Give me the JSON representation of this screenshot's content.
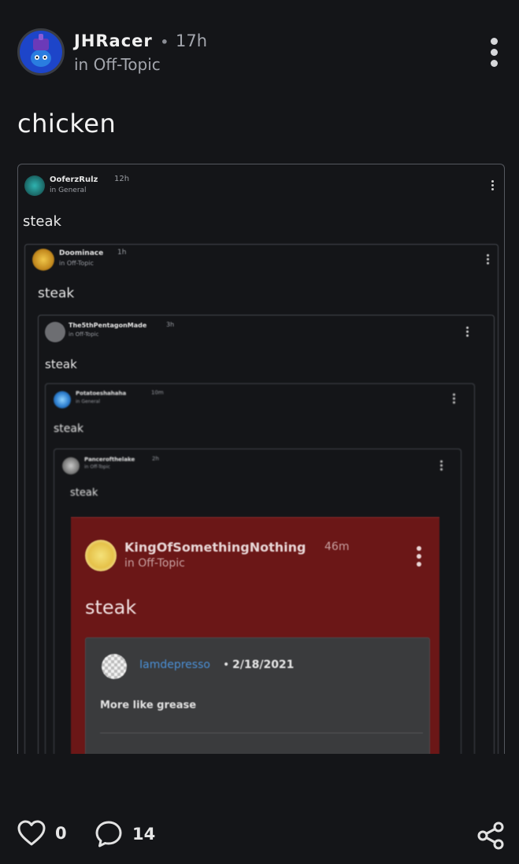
{
  "post": {
    "author": "JHRacer",
    "time": "17h",
    "community": "in Off-Topic",
    "text": "chicken"
  },
  "screenshot": {
    "level1": {
      "author": "OoferzRulz",
      "time": "12h",
      "community": "in General",
      "text": "steak"
    },
    "level2": {
      "author": "Doominace",
      "time": "1h",
      "community": "in Off-Topic",
      "text": "steak"
    },
    "level3": {
      "author": "The5thPentagonMade",
      "time": "3h",
      "community": "in Off-Topic",
      "text": "steak"
    },
    "level4": {
      "author": "Potatoeshahaha",
      "time": "10m",
      "community": "in General",
      "text": "steak"
    },
    "level5": {
      "author": "Pancerofthelake",
      "time": "2h",
      "community": "in Off-Topic",
      "text": "steak"
    },
    "level6": {
      "author": "KingOfSomethingNothing",
      "time": "46m",
      "community": "in Off-Topic",
      "text": "steak"
    },
    "comment": {
      "author": "Iamdepresso",
      "date": "2/18/2021",
      "text": "More like grease"
    }
  },
  "footer": {
    "likes": "0",
    "comments": "14"
  },
  "colors": {
    "background": "#141518",
    "accent_card": "#6b1717",
    "link_blue": "#4a8fd6"
  },
  "icons": [
    "more-vertical-icon",
    "heart-icon",
    "comment-icon",
    "share-icon"
  ]
}
